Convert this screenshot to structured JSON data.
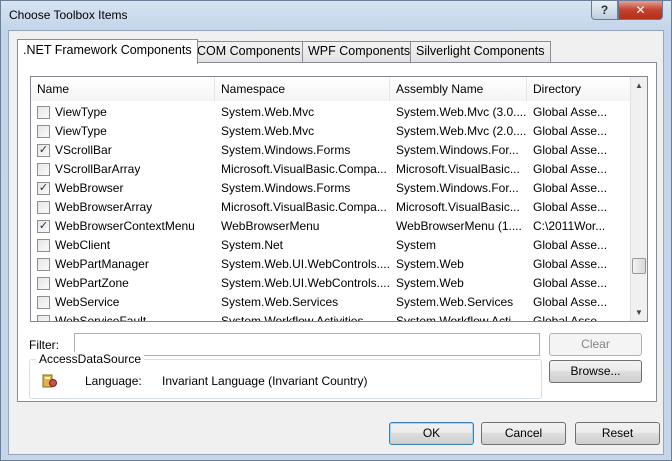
{
  "window": {
    "title": "Choose Toolbox Items",
    "help_label": "?",
    "close_label": "✕"
  },
  "tabs": [
    {
      "label": ".NET Framework Components",
      "active": true
    },
    {
      "label": "COM Components",
      "active": false
    },
    {
      "label": "WPF Components",
      "active": false
    },
    {
      "label": "Silverlight Components",
      "active": false
    }
  ],
  "table": {
    "columns": [
      "Name",
      "Namespace",
      "Assembly Name",
      "Directory"
    ],
    "rows": [
      {
        "checked": false,
        "name": "ViewType",
        "namespace": "System.Web.Mvc",
        "assembly": "System.Web.Mvc (3.0....",
        "directory": "Global Asse..."
      },
      {
        "checked": false,
        "name": "ViewType",
        "namespace": "System.Web.Mvc",
        "assembly": "System.Web.Mvc (2.0....",
        "directory": "Global Asse..."
      },
      {
        "checked": true,
        "name": "VScrollBar",
        "namespace": "System.Windows.Forms",
        "assembly": "System.Windows.For...",
        "directory": "Global Asse..."
      },
      {
        "checked": false,
        "name": "VScrollBarArray",
        "namespace": "Microsoft.VisualBasic.Compa...",
        "assembly": "Microsoft.VisualBasic...",
        "directory": "Global Asse..."
      },
      {
        "checked": true,
        "name": "WebBrowser",
        "namespace": "System.Windows.Forms",
        "assembly": "System.Windows.For...",
        "directory": "Global Asse..."
      },
      {
        "checked": false,
        "name": "WebBrowserArray",
        "namespace": "Microsoft.VisualBasic.Compa...",
        "assembly": "Microsoft.VisualBasic...",
        "directory": "Global Asse..."
      },
      {
        "checked": true,
        "name": "WebBrowserContextMenu",
        "namespace": "WebBrowserMenu",
        "assembly": "WebBrowserMenu (1....",
        "directory": "C:\\2011Wor..."
      },
      {
        "checked": false,
        "name": "WebClient",
        "namespace": "System.Net",
        "assembly": "System",
        "directory": "Global Asse..."
      },
      {
        "checked": false,
        "name": "WebPartManager",
        "namespace": "System.Web.UI.WebControls....",
        "assembly": "System.Web",
        "directory": "Global Asse..."
      },
      {
        "checked": false,
        "name": "WebPartZone",
        "namespace": "System.Web.UI.WebControls....",
        "assembly": "System.Web",
        "directory": "Global Asse..."
      },
      {
        "checked": false,
        "name": "WebService",
        "namespace": "System.Web.Services",
        "assembly": "System.Web.Services",
        "directory": "Global Asse..."
      },
      {
        "checked": false,
        "name": "WebServiceFault...",
        "namespace": "System.Workflow.Activities",
        "assembly": "System.Workflow.Acti...",
        "directory": "Global Asse..."
      }
    ]
  },
  "filter": {
    "label": "Filter:",
    "value": "",
    "clear_label": "Clear"
  },
  "details": {
    "group_title": "AccessDataSource",
    "language_label": "Language:",
    "language_value": "Invariant Language (Invariant Country)",
    "browse_label": "Browse..."
  },
  "footer": {
    "ok_label": "OK",
    "cancel_label": "Cancel",
    "reset_label": "Reset"
  }
}
